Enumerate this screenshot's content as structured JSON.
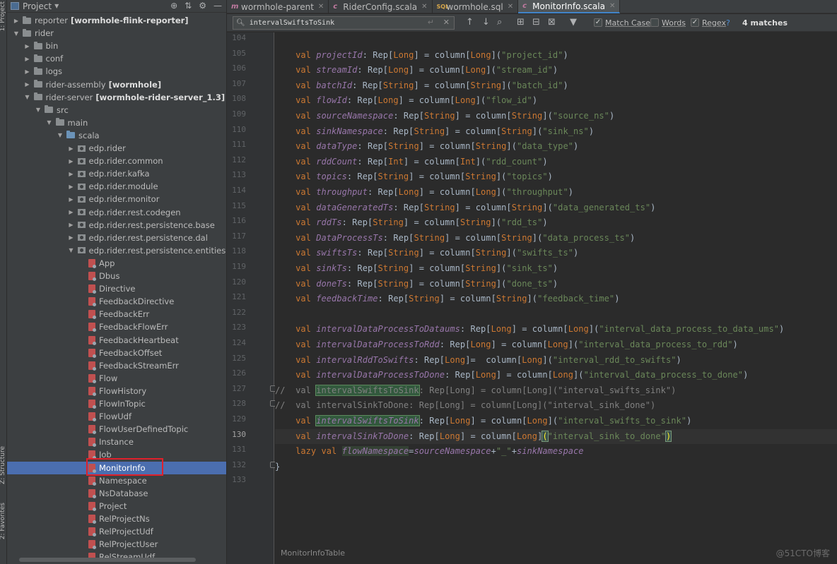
{
  "side_labels": {
    "top": "1: Project",
    "mid": "Z: Structure",
    "bottom": "2: Favorites"
  },
  "project_panel": {
    "title": "Project",
    "icons": [
      "target-icon",
      "collapse-icon",
      "gear-icon",
      "hide-icon"
    ],
    "tree": [
      {
        "label": "reporter",
        "extra": "[wormhole-flink-reporter]",
        "type": "folder",
        "arrow": "▶",
        "indent": 0
      },
      {
        "label": "rider",
        "extra": "",
        "type": "folder",
        "arrow": "▼",
        "indent": 0
      },
      {
        "label": "bin",
        "extra": "",
        "type": "folder",
        "arrow": "▶",
        "indent": 1
      },
      {
        "label": "conf",
        "extra": "",
        "type": "folder",
        "arrow": "▶",
        "indent": 1
      },
      {
        "label": "logs",
        "extra": "",
        "type": "folder",
        "arrow": "▶",
        "indent": 1
      },
      {
        "label": "rider-assembly",
        "extra": "[wormhole]",
        "type": "folder",
        "arrow": "▶",
        "indent": 1
      },
      {
        "label": "rider-server",
        "extra": "[wormhole-rider-server_1.3]",
        "type": "folder",
        "arrow": "▼",
        "indent": 1
      },
      {
        "label": "src",
        "extra": "",
        "type": "folder",
        "arrow": "▼",
        "indent": 2
      },
      {
        "label": "main",
        "extra": "",
        "type": "folder",
        "arrow": "▼",
        "indent": 3
      },
      {
        "label": "scala",
        "extra": "",
        "type": "folder-blue",
        "arrow": "▼",
        "indent": 4
      },
      {
        "label": "edp.rider",
        "extra": "",
        "type": "pkg",
        "arrow": "▶",
        "indent": 5
      },
      {
        "label": "edp.rider.common",
        "extra": "",
        "type": "pkg",
        "arrow": "▶",
        "indent": 5
      },
      {
        "label": "edp.rider.kafka",
        "extra": "",
        "type": "pkg",
        "arrow": "▶",
        "indent": 5
      },
      {
        "label": "edp.rider.module",
        "extra": "",
        "type": "pkg",
        "arrow": "▶",
        "indent": 5
      },
      {
        "label": "edp.rider.monitor",
        "extra": "",
        "type": "pkg",
        "arrow": "▶",
        "indent": 5
      },
      {
        "label": "edp.rider.rest.codegen",
        "extra": "",
        "type": "pkg",
        "arrow": "▶",
        "indent": 5
      },
      {
        "label": "edp.rider.rest.persistence.base",
        "extra": "",
        "type": "pkg",
        "arrow": "▶",
        "indent": 5
      },
      {
        "label": "edp.rider.rest.persistence.dal",
        "extra": "",
        "type": "pkg",
        "arrow": "▶",
        "indent": 5
      },
      {
        "label": "edp.rider.rest.persistence.entities",
        "extra": "",
        "type": "pkg",
        "arrow": "▼",
        "indent": 5
      },
      {
        "label": "App",
        "extra": "",
        "type": "cls",
        "arrow": "",
        "indent": 6
      },
      {
        "label": "Dbus",
        "extra": "",
        "type": "cls",
        "arrow": "",
        "indent": 6
      },
      {
        "label": "Directive",
        "extra": "",
        "type": "cls",
        "arrow": "",
        "indent": 6
      },
      {
        "label": "FeedbackDirective",
        "extra": "",
        "type": "cls",
        "arrow": "",
        "indent": 6
      },
      {
        "label": "FeedbackErr",
        "extra": "",
        "type": "cls",
        "arrow": "",
        "indent": 6
      },
      {
        "label": "FeedbackFlowErr",
        "extra": "",
        "type": "cls",
        "arrow": "",
        "indent": 6
      },
      {
        "label": "FeedbackHeartbeat",
        "extra": "",
        "type": "cls",
        "arrow": "",
        "indent": 6
      },
      {
        "label": "FeedbackOffset",
        "extra": "",
        "type": "cls",
        "arrow": "",
        "indent": 6
      },
      {
        "label": "FeedbackStreamErr",
        "extra": "",
        "type": "cls",
        "arrow": "",
        "indent": 6
      },
      {
        "label": "Flow",
        "extra": "",
        "type": "cls",
        "arrow": "",
        "indent": 6
      },
      {
        "label": "FlowHistory",
        "extra": "",
        "type": "cls",
        "arrow": "",
        "indent": 6
      },
      {
        "label": "FlowInTopic",
        "extra": "",
        "type": "cls",
        "arrow": "",
        "indent": 6
      },
      {
        "label": "FlowUdf",
        "extra": "",
        "type": "cls",
        "arrow": "",
        "indent": 6
      },
      {
        "label": "FlowUserDefinedTopic",
        "extra": "",
        "type": "cls",
        "arrow": "",
        "indent": 6
      },
      {
        "label": "Instance",
        "extra": "",
        "type": "cls",
        "arrow": "",
        "indent": 6
      },
      {
        "label": "Job",
        "extra": "",
        "type": "cls",
        "arrow": "",
        "indent": 6
      },
      {
        "label": "MonitorInfo",
        "extra": "",
        "type": "cls",
        "arrow": "",
        "indent": 6,
        "selected": true
      },
      {
        "label": "Namespace",
        "extra": "",
        "type": "cls",
        "arrow": "",
        "indent": 6
      },
      {
        "label": "NsDatabase",
        "extra": "",
        "type": "cls",
        "arrow": "",
        "indent": 6
      },
      {
        "label": "Project",
        "extra": "",
        "type": "cls",
        "arrow": "",
        "indent": 6
      },
      {
        "label": "RelProjectNs",
        "extra": "",
        "type": "cls",
        "arrow": "",
        "indent": 6
      },
      {
        "label": "RelProjectUdf",
        "extra": "",
        "type": "cls",
        "arrow": "",
        "indent": 6
      },
      {
        "label": "RelProjectUser",
        "extra": "",
        "type": "cls",
        "arrow": "",
        "indent": 6
      },
      {
        "label": "RelStreamUdf",
        "extra": "",
        "type": "cls",
        "arrow": "",
        "indent": 6
      }
    ]
  },
  "tabs": [
    {
      "label": "wormhole-parent",
      "icon": "m",
      "active": false
    },
    {
      "label": "RiderConfig.scala",
      "icon": "scala",
      "active": false
    },
    {
      "label": "wormhole.sql",
      "icon": "sql",
      "active": false
    },
    {
      "label": "MonitorInfo.scala",
      "icon": "scala",
      "active": true
    }
  ],
  "search": {
    "value": "intervalSwiftsToSink",
    "match_case_label": "Match Case",
    "match_case": true,
    "words_label": "Words",
    "words": false,
    "regex_label": "Regex",
    "regex": true,
    "help": "?",
    "matches": "4 matches"
  },
  "code_lines": [
    {
      "n": "104",
      "code": ""
    },
    {
      "n": "105",
      "code": "    val projectId: Rep[Long] = column[Long](\"project_id\")"
    },
    {
      "n": "106",
      "code": "    val streamId: Rep[Long] = column[Long](\"stream_id\")"
    },
    {
      "n": "107",
      "code": "    val batchId: Rep[String] = column[String](\"batch_id\")"
    },
    {
      "n": "108",
      "code": "    val flowId: Rep[Long] = column[Long](\"flow_id\")"
    },
    {
      "n": "109",
      "code": "    val sourceNamespace: Rep[String] = column[String](\"source_ns\")"
    },
    {
      "n": "110",
      "code": "    val sinkNamespace: Rep[String] = column[String](\"sink_ns\")"
    },
    {
      "n": "111",
      "code": "    val dataType: Rep[String] = column[String](\"data_type\")"
    },
    {
      "n": "112",
      "code": "    val rddCount: Rep[Int] = column[Int](\"rdd_count\")"
    },
    {
      "n": "113",
      "code": "    val topics: Rep[String] = column[String](\"topics\")"
    },
    {
      "n": "114",
      "code": "    val throughput: Rep[Long] = column[Long](\"throughput\")"
    },
    {
      "n": "115",
      "code": "    val dataGeneratedTs: Rep[String] = column[String](\"data_generated_ts\")"
    },
    {
      "n": "116",
      "code": "    val rddTs: Rep[String] = column[String](\"rdd_ts\")"
    },
    {
      "n": "117",
      "code": "    val DataProcessTs: Rep[String] = column[String](\"data_process_ts\")"
    },
    {
      "n": "118",
      "code": "    val swiftsTs: Rep[String] = column[String](\"swifts_ts\")"
    },
    {
      "n": "119",
      "code": "    val sinkTs: Rep[String] = column[String](\"sink_ts\")"
    },
    {
      "n": "120",
      "code": "    val doneTs: Rep[String] = column[String](\"done_ts\")"
    },
    {
      "n": "121",
      "code": "    val feedbackTime: Rep[String] = column[String](\"feedback_time\")"
    },
    {
      "n": "122",
      "code": ""
    },
    {
      "n": "123",
      "code": "    val intervalDataProcessToDataums: Rep[Long] = column[Long](\"interval_data_process_to_data_ums\")"
    },
    {
      "n": "124",
      "code": "    val intervalDataProcessToRdd: Rep[Long] = column[Long](\"interval_data_process_to_rdd\")"
    },
    {
      "n": "125",
      "code": "    val intervalRddToSwifts: Rep[Long]=  column[Long](\"interval_rdd_to_swifts\")"
    },
    {
      "n": "126",
      "code": "    val intervalDataProcessToDone: Rep[Long] = column[Long](\"interval_data_process_to_done\")"
    },
    {
      "n": "127",
      "code": "//  val intervalSwiftsToSink: Rep[Long] = column[Long](\"interval_swifts_sink\")"
    },
    {
      "n": "128",
      "code": "//  val intervalSinkToDone: Rep[Long] = column[Long](\"interval_sink_done\")"
    },
    {
      "n": "129",
      "code": "    val intervalSwiftsToSink: Rep[Long] = column[Long](\"interval_swifts_to_sink\")"
    },
    {
      "n": "130",
      "code": "    val intervalSinkToDone: Rep[Long] = column[Long](\"interval_sink_to_done\")"
    },
    {
      "n": "131",
      "code": "    lazy val flowNamespace=sourceNamespace+\"_\"+sinkNamespace"
    },
    {
      "n": "132",
      "code": "}"
    },
    {
      "n": "133",
      "code": ""
    }
  ],
  "breadcrumb": "MonitorInfoTable",
  "watermark": "@51CTO博客"
}
